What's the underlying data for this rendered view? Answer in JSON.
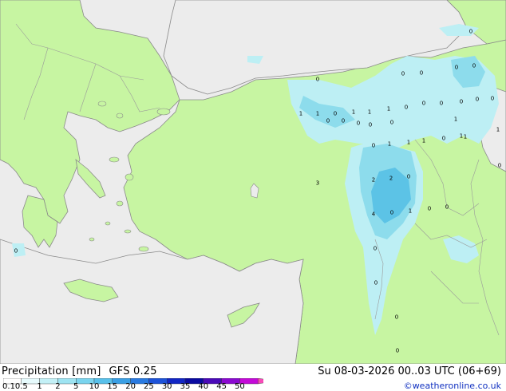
{
  "colors": {
    "sea": "#ececec",
    "land": "#c7f5a2",
    "coast": "#8a8a8a",
    "border": "#9a9a9a",
    "precip_light": "#bdeff4",
    "precip_mid": "#8ddcec",
    "precip_strong": "#5cc3e6"
  },
  "map": {
    "labels": [
      "0",
      "0",
      "0",
      "0",
      "0",
      "0",
      "0",
      "1",
      "1",
      "0",
      "1",
      "1",
      "1",
      "0",
      "0",
      "0",
      "0",
      "0",
      "0",
      "0",
      "0",
      "0",
      "1",
      "0",
      "1",
      "1",
      "0",
      "1",
      "1",
      "1",
      "0",
      "1",
      "2",
      "2",
      "0",
      "3",
      "4",
      "0",
      "1",
      "0",
      "0",
      "0",
      "0",
      "0",
      "0",
      "0",
      "0"
    ]
  },
  "footer": {
    "title": "Precipitation [mm]",
    "model": "GFS 0.25",
    "valid": "Su 08-03-2026 00..03 UTC (06+69)",
    "credit": "©weatheronline.co.uk"
  },
  "legend": {
    "ticks": [
      "0.1",
      "0.5",
      "1",
      "2",
      "5",
      "10",
      "15",
      "20",
      "25",
      "30",
      "35",
      "40",
      "45",
      "50"
    ],
    "colors": [
      "#ffffff",
      "#e6fafc",
      "#c3f0f6",
      "#9ee4f2",
      "#7ad4ee",
      "#58c0ea",
      "#3a9fe4",
      "#2a7ae0",
      "#1d52d8",
      "#1226c4",
      "#0a0aa0",
      "#4a0ab8",
      "#8a0ad0",
      "#c40ad8",
      "#e80ac8",
      "#f84ab8"
    ]
  }
}
